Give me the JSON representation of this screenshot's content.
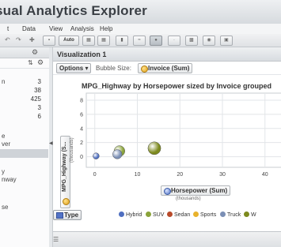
{
  "window": {
    "title": "sual Analytics Explorer"
  },
  "menu": [
    {
      "label": "t"
    },
    {
      "label": "Data"
    },
    {
      "label": "View"
    },
    {
      "label": "Analysis"
    },
    {
      "label": "Help"
    }
  ],
  "toolbar": {
    "auto_label": "Auto",
    "undo_icon": "undo-icon",
    "redo_icon": "redo-icon",
    "zoom_icon": "zoom-icon"
  },
  "left_panel": {
    "rows": [
      {
        "label": "n",
        "value": "3"
      },
      {
        "label": "",
        "value": "38"
      },
      {
        "label": "",
        "value": "425"
      },
      {
        "label": "",
        "value": "3"
      },
      {
        "label": "",
        "value": "6"
      }
    ],
    "items": [
      {
        "label": "e"
      },
      {
        "label": "ver"
      },
      {
        "label": ""
      },
      {
        "label": ""
      },
      {
        "label": "y"
      },
      {
        "label": "nway"
      },
      {
        "label": ""
      },
      {
        "label": "se"
      }
    ]
  },
  "visualization": {
    "title": "Visualization 1",
    "options_label": "Options ▾",
    "bubble_size_label": "Bubble Size:",
    "bubble_size_field": "Invoice (Sum)",
    "x_field": "Horsepower (Sum)",
    "y_field": "MPG_Highway (S...",
    "type_label": "Type"
  },
  "chart_data": {
    "type": "scatter",
    "title": "MPG_Highway by Horsepower sized by Invoice grouped",
    "xlabel": "Horsepower (Sum)",
    "x_unit": "(thousands)",
    "ylabel": "MPG_Highway (S...",
    "y_unit": "(thousands)",
    "xlim": [
      -2,
      46
    ],
    "ylim": [
      -1.5,
      9
    ],
    "x_ticks": [
      0,
      10,
      20,
      30,
      40
    ],
    "y_ticks": [
      0,
      2,
      4,
      6,
      8
    ],
    "grid": true,
    "legend_title": "Type",
    "legend_position": "bottom",
    "series": [
      {
        "name": "Hybrid",
        "color": "#4f6fc0",
        "points": [
          {
            "x": 0.3,
            "y": 0.1,
            "size": 0.3
          }
        ]
      },
      {
        "name": "SUV",
        "color": "#8aa33a",
        "points": [
          {
            "x": 5.8,
            "y": 0.8,
            "size": 1.2
          }
        ]
      },
      {
        "name": "Sedan",
        "color": "#b84a2a",
        "points": []
      },
      {
        "name": "Sports",
        "color": "#e8b22c",
        "points": []
      },
      {
        "name": "Truck",
        "color": "#7b8fb5",
        "points": [
          {
            "x": 5.3,
            "y": 0.35,
            "size": 0.9
          }
        ]
      },
      {
        "name": "W",
        "color": "#7d8a1e",
        "points": [
          {
            "x": 14,
            "y": 1.2,
            "size": 1.6
          }
        ]
      }
    ]
  }
}
